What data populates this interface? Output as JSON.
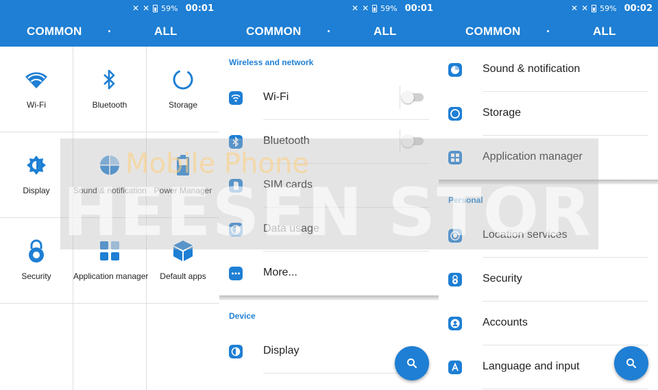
{
  "status": {
    "battery": "59%",
    "times": [
      "00:01",
      "00:01",
      "00:02"
    ]
  },
  "tabs": {
    "common": "COMMON",
    "all": "ALL"
  },
  "grid": [
    {
      "label": "Wi-Fi",
      "icon": "wifi-icon"
    },
    {
      "label": "Bluetooth",
      "icon": "bluetooth-icon"
    },
    {
      "label": "Storage",
      "icon": "storage-icon"
    },
    {
      "label": "Display",
      "icon": "display-icon"
    },
    {
      "label": "Sound & notification",
      "icon": "sound-notification-icon"
    },
    {
      "label": "Power Manager",
      "icon": "battery-icon"
    },
    {
      "label": "Security",
      "icon": "lock-icon"
    },
    {
      "label": "Application manager",
      "icon": "apps-icon"
    },
    {
      "label": "Default apps",
      "icon": "cube-icon"
    }
  ],
  "panel2": {
    "section_wireless": "Wireless and network",
    "wireless": [
      {
        "label": "Wi-Fi",
        "icon": "wifi-icon",
        "toggle": "off"
      },
      {
        "label": "Bluetooth",
        "icon": "bluetooth-icon",
        "toggle": "off"
      },
      {
        "label": "SIM cards",
        "icon": "sim-card-icon"
      },
      {
        "label": "Data usage",
        "icon": "data-usage-icon"
      },
      {
        "label": "More...",
        "icon": "more-icon"
      }
    ],
    "section_device": "Device",
    "device": [
      {
        "label": "Display",
        "icon": "display-icon"
      }
    ]
  },
  "panel3": {
    "device": [
      {
        "label": "Sound & notification",
        "icon": "sound-notification-icon"
      },
      {
        "label": "Storage",
        "icon": "storage-icon"
      },
      {
        "label": "Application manager",
        "icon": "apps-icon"
      }
    ],
    "section_personal": "Personal",
    "personal": [
      {
        "label": "Location services",
        "icon": "location-icon"
      },
      {
        "label": "Security",
        "icon": "lock-icon"
      },
      {
        "label": "Accounts",
        "icon": "account-icon"
      },
      {
        "label": "Language and input",
        "icon": "language-icon"
      }
    ]
  },
  "watermark": {
    "line1": "Mobile Phone",
    "line2": "HEESEN STORE"
  },
  "colors": {
    "accent": "#1e7fd4",
    "toggle_off": "#d0d0d0"
  }
}
